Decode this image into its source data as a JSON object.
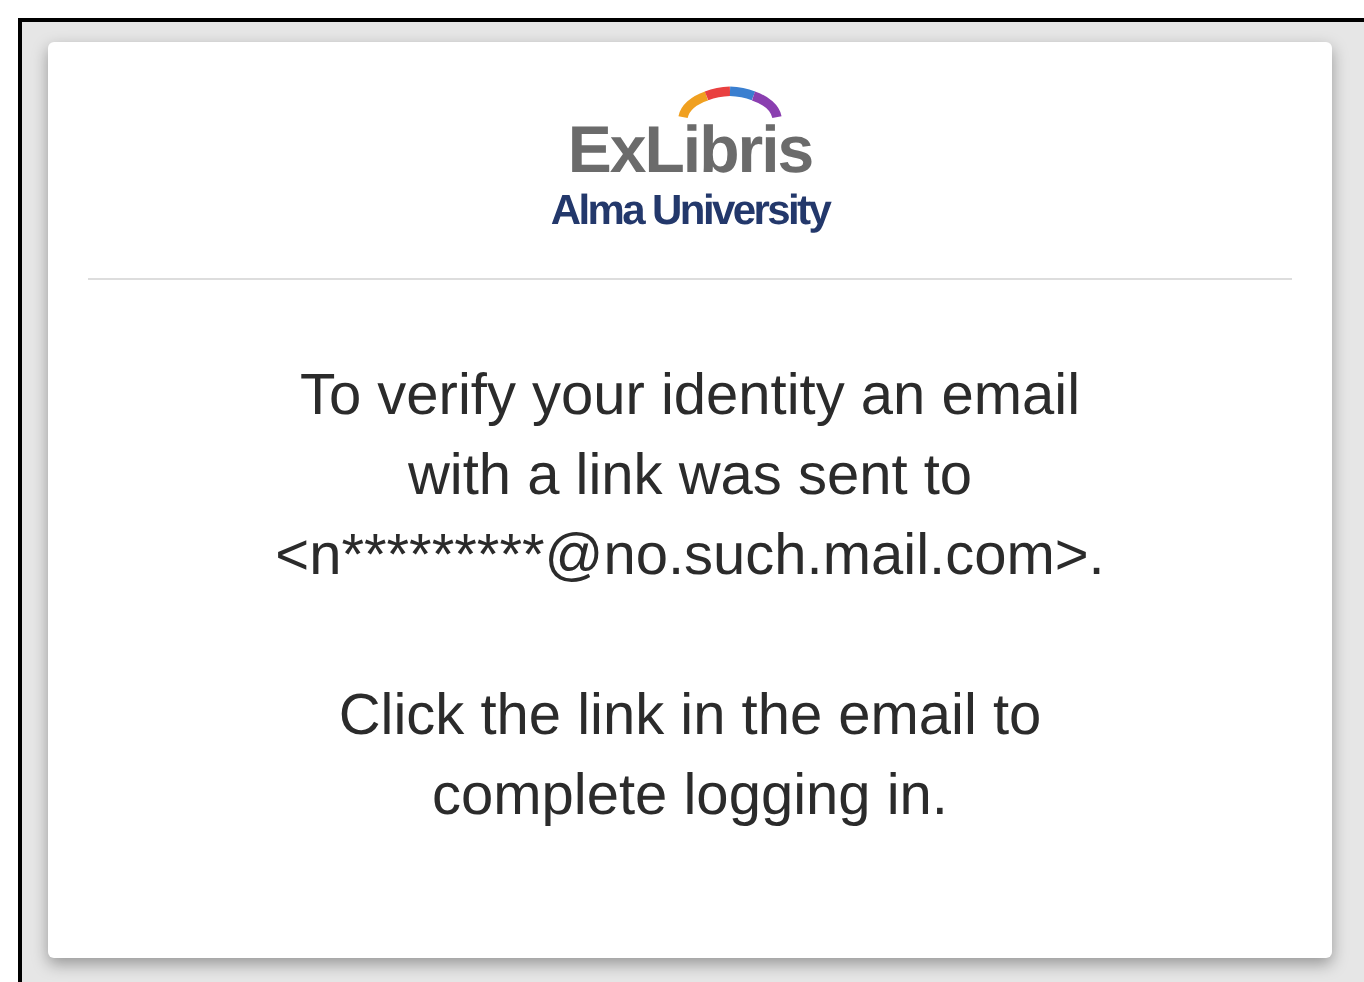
{
  "logo": {
    "brand": "ExLibris",
    "institution": "Alma University"
  },
  "messages": [
    {
      "lines": [
        "To verify your identity an email",
        "with a link was sent to",
        "<n*********@no.such.mail.com>."
      ]
    },
    {
      "lines": [
        "Click the link in the email to",
        "complete logging in."
      ]
    }
  ]
}
